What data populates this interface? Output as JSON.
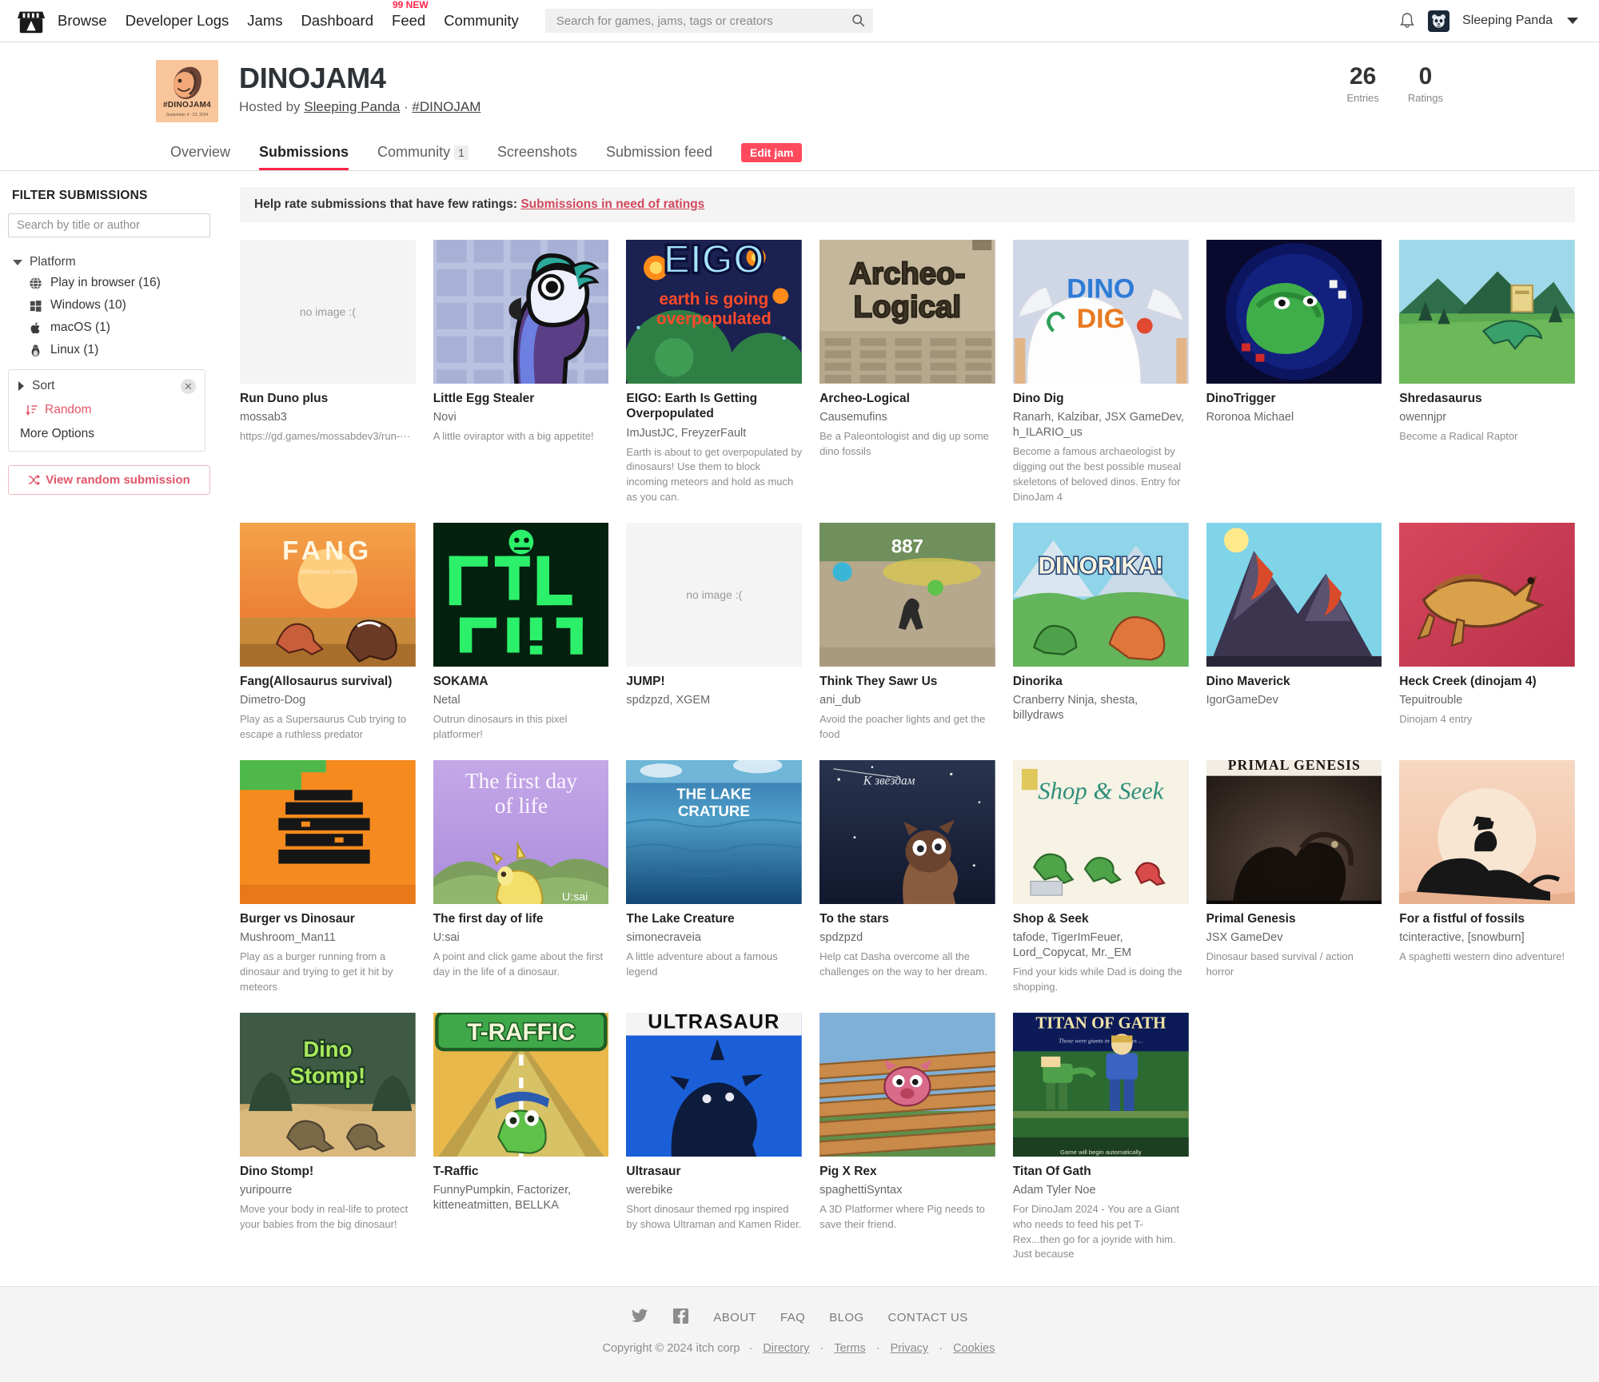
{
  "nav": {
    "logo_icon": "itch-io-logo",
    "links": [
      {
        "label": "Browse"
      },
      {
        "label": "Developer Logs"
      },
      {
        "label": "Jams"
      },
      {
        "label": "Dashboard"
      },
      {
        "label": "Feed",
        "badge": "99 NEW"
      },
      {
        "label": "Community"
      }
    ],
    "search_placeholder": "Search for games, jams, tags or creators",
    "search_value": "",
    "bell_icon": "notification-bell-icon",
    "user_name": "Sleeping Panda",
    "avatar_icon": "panda-avatar-icon",
    "caret_icon": "chevron-down-icon"
  },
  "jam": {
    "cover_label": "#DINOJAM4",
    "cover_dates": "September 4 - 23, 2024",
    "title": "DINOJAM4",
    "hosted_prefix": "Hosted by ",
    "host": "Sleeping Panda",
    "separator": " · ",
    "hashtag": "#DINOJAM",
    "stats": [
      {
        "num": "26",
        "label": "Entries"
      },
      {
        "num": "0",
        "label": "Ratings"
      }
    ]
  },
  "tabs": [
    {
      "label": "Overview",
      "active": false
    },
    {
      "label": "Submissions",
      "active": true
    },
    {
      "label": "Community",
      "count": "1",
      "active": false
    },
    {
      "label": "Screenshots",
      "active": false
    },
    {
      "label": "Submission feed",
      "active": false
    }
  ],
  "edit_jam_label": "Edit jam",
  "sidebar": {
    "heading": "FILTER SUBMISSIONS",
    "search_placeholder": "Search by title or author",
    "search_value": "",
    "platform_group": {
      "label": "Platform",
      "expanded": true,
      "items": [
        {
          "label": "Play in browser (16)",
          "icon": "globe-icon"
        },
        {
          "label": "Windows (10)",
          "icon": "windows-icon"
        },
        {
          "label": "macOS (1)",
          "icon": "apple-icon"
        },
        {
          "label": "Linux (1)",
          "icon": "linux-tux-icon"
        }
      ]
    },
    "sort": {
      "label": "Sort",
      "expanded": false,
      "close_icon": "close-x-icon",
      "selected": "Random",
      "selected_icon": "sort-descending-icon",
      "more_options": "More Options"
    },
    "random_button": {
      "label": "View random submission",
      "icon": "shuffle-icon"
    }
  },
  "help_bar": {
    "text": "Help rate submissions that have few ratings: ",
    "link": "Submissions in need of ratings"
  },
  "submissions": [
    {
      "title": "Run Duno plus",
      "author": "mossab3",
      "desc": "https://gd.games/mossabdev3/run-···",
      "thumb": "none",
      "noimg_text": "no image :("
    },
    {
      "title": "Little Egg Stealer",
      "author": "Novi",
      "desc": "A little oviraptor with a big appetite!",
      "thumb": "oviraptor"
    },
    {
      "title": "EIGO: Earth Is Getting Overpopulated",
      "author": "ImJustJC, FreyzerFault",
      "desc": "Earth is about to get overpopulated by dinosaurs! Use them to block incoming meteors and hold as much as you can.",
      "thumb": "eigo"
    },
    {
      "title": "Archeo-Logical",
      "author": "Causemufins",
      "desc": "Be a Paleontologist and dig up some dino fossils",
      "thumb": "archeo"
    },
    {
      "title": "Dino Dig",
      "author": "Ranarh, Kalzibar, JSX GameDev, h_ILARIO_us",
      "desc": "Become a famous archaeologist by digging out the best possible museal skeletons of beloved dinos. Entry for DinoJam 4",
      "thumb": "dinodig"
    },
    {
      "title": "DinoTrigger",
      "author": "Roronoa Michael",
      "desc": "",
      "thumb": "dinotrigger"
    },
    {
      "title": "Shredasaurus",
      "author": "owennjpr",
      "desc": "Become a Radical Raptor",
      "thumb": "shreda"
    },
    {
      "title": "Fang(Allosaurus survival)",
      "author": "Dimetro-Dog",
      "desc": "Play as a Supersaurus Cub trying to escape a ruthless predator",
      "thumb": "fang"
    },
    {
      "title": "SOKAMA",
      "author": "Netal",
      "desc": "Outrun dinosaurs in this pixel platformer!",
      "thumb": "sokama"
    },
    {
      "title": "JUMP!",
      "author": "spdzpzd, XGEM",
      "desc": "",
      "thumb": "none",
      "noimg_text": "no image :("
    },
    {
      "title": "Think They Sawr Us",
      "author": "ani_dub",
      "desc": "Avoid the poacher lights and get the food",
      "thumb": "sawrus",
      "overlay_number": "887"
    },
    {
      "title": "Dinorika",
      "author": "Cranberry Ninja, shesta, billydraws",
      "desc": "",
      "thumb": "dinorika"
    },
    {
      "title": "Dino Maverick",
      "author": "IgorGameDev",
      "desc": "",
      "thumb": "maverick"
    },
    {
      "title": "Heck Creek (dinojam 4)",
      "author": "Tepuitrouble",
      "desc": "Dinojam 4 entry",
      "thumb": "heckcreek"
    },
    {
      "title": "Burger vs Dinosaur",
      "author": "Mushroom_Man11",
      "desc": "Play as a burger running from a dinosaur and trying to get it hit by meteors",
      "thumb": "burger"
    },
    {
      "title": "The first day of life",
      "author": "U:sai",
      "desc": "A point and click game about the first day in the life of a dinosaur.",
      "thumb": "firstday",
      "overlay_title": "The first day\nof life",
      "overlay_credit": "U:sai"
    },
    {
      "title": "The Lake Creature",
      "author": "simonecraveia",
      "desc": "A little adventure about a famous legend",
      "thumb": "lake",
      "overlay_title": "THE LAKE\nCRATURE"
    },
    {
      "title": "To the stars",
      "author": "spdzpzd",
      "desc": "Help cat Dasha overcome all the challenges on the way to her dream.",
      "thumb": "tothestars"
    },
    {
      "title": "Shop & Seek",
      "author": "tafode, TigerImFeuer, Lord_Copycat, Mr._EM",
      "desc": "Find your kids while Dad is doing the shopping.",
      "thumb": "shopseek",
      "overlay_title": "Shop & Seek"
    },
    {
      "title": "Primal Genesis",
      "author": "JSX GameDev",
      "desc": "Dinosaur based survival / action horror",
      "thumb": "primal",
      "overlay_title": "PRIMAL GENESIS"
    },
    {
      "title": "For a fistful of fossils",
      "author": "tcinteractive, [snowburn]",
      "desc": "A spaghetti western dino adventure!",
      "thumb": "fistful"
    },
    {
      "title": "Dino Stomp!",
      "author": "yuripourre",
      "desc": "Move your body in real-life to protect your babies from the big dinosaur!",
      "thumb": "dinostomp",
      "overlay_title": "Dino\nStomp!"
    },
    {
      "title": "T-Raffic",
      "author": "FunnyPumpkin, Factorizer, kitteneatmitten, BELLKA",
      "desc": "",
      "thumb": "traffic",
      "overlay_title": "T-RAFFIC"
    },
    {
      "title": "Ultrasaur",
      "author": "werebike",
      "desc": "Short dinosaur themed rpg inspired by showa Ultraman and Kamen Rider.",
      "thumb": "ultrasaur",
      "overlay_title": "ULTRASAUR"
    },
    {
      "title": "Pig X Rex",
      "author": "spaghettiSyntax",
      "desc": "A 3D Platformer where Pig needs to save their friend.",
      "thumb": "pigxrex"
    },
    {
      "title": "Titan Of Gath",
      "author": "Adam Tyler Noe",
      "desc": "For DinoJam 2024 - You are a Giant who needs to feed his pet T-Rex...then go for a joyride with him. Just because",
      "thumb": "titan",
      "overlay_title": "TITAN OF GATH",
      "overlay_sub": "Those were giants in those days ...",
      "overlay_foot": "Game will begin automatically"
    }
  ],
  "footer": {
    "social": [
      {
        "icon": "twitter-icon"
      },
      {
        "icon": "facebook-icon"
      }
    ],
    "links": [
      {
        "label": "ABOUT"
      },
      {
        "label": "FAQ"
      },
      {
        "label": "BLOG"
      },
      {
        "label": "CONTACT US"
      }
    ],
    "copyright": "Copyright © 2024 itch corp",
    "legal": [
      {
        "label": "Directory"
      },
      {
        "label": "Terms"
      },
      {
        "label": "Privacy"
      },
      {
        "label": "Cookies"
      }
    ]
  },
  "colors": {
    "accent_red": "#ff2449",
    "link_red": "#e2576b",
    "edit_button": "#ff4a5e",
    "jam_cover_bg": "#f9c69b"
  }
}
